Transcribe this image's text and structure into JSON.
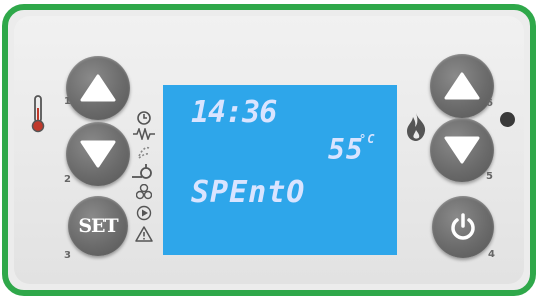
{
  "display": {
    "time": "14:36",
    "temperature": "55",
    "temperature_unit": "°C",
    "status": "SPEntO"
  },
  "buttons": {
    "set_label": "SET",
    "num_1": "1",
    "num_2": "2",
    "num_3": "3",
    "num_4": "4",
    "num_5": "5",
    "num_6": "6"
  },
  "icons": {
    "left": [
      "thermometer-icon",
      "clock-icon",
      "resistor-icon",
      "fan-leaves-icon",
      "pump-icon",
      "fan-icon",
      "play-icon",
      "warning-icon"
    ],
    "right": [
      "flame-icon",
      "led-indicator"
    ]
  },
  "colors": {
    "frame": "#2fa84a",
    "lcd_background": "#2ea6ea",
    "lcd_segments": "#d9e4ff",
    "button": "#6b6b6b"
  }
}
